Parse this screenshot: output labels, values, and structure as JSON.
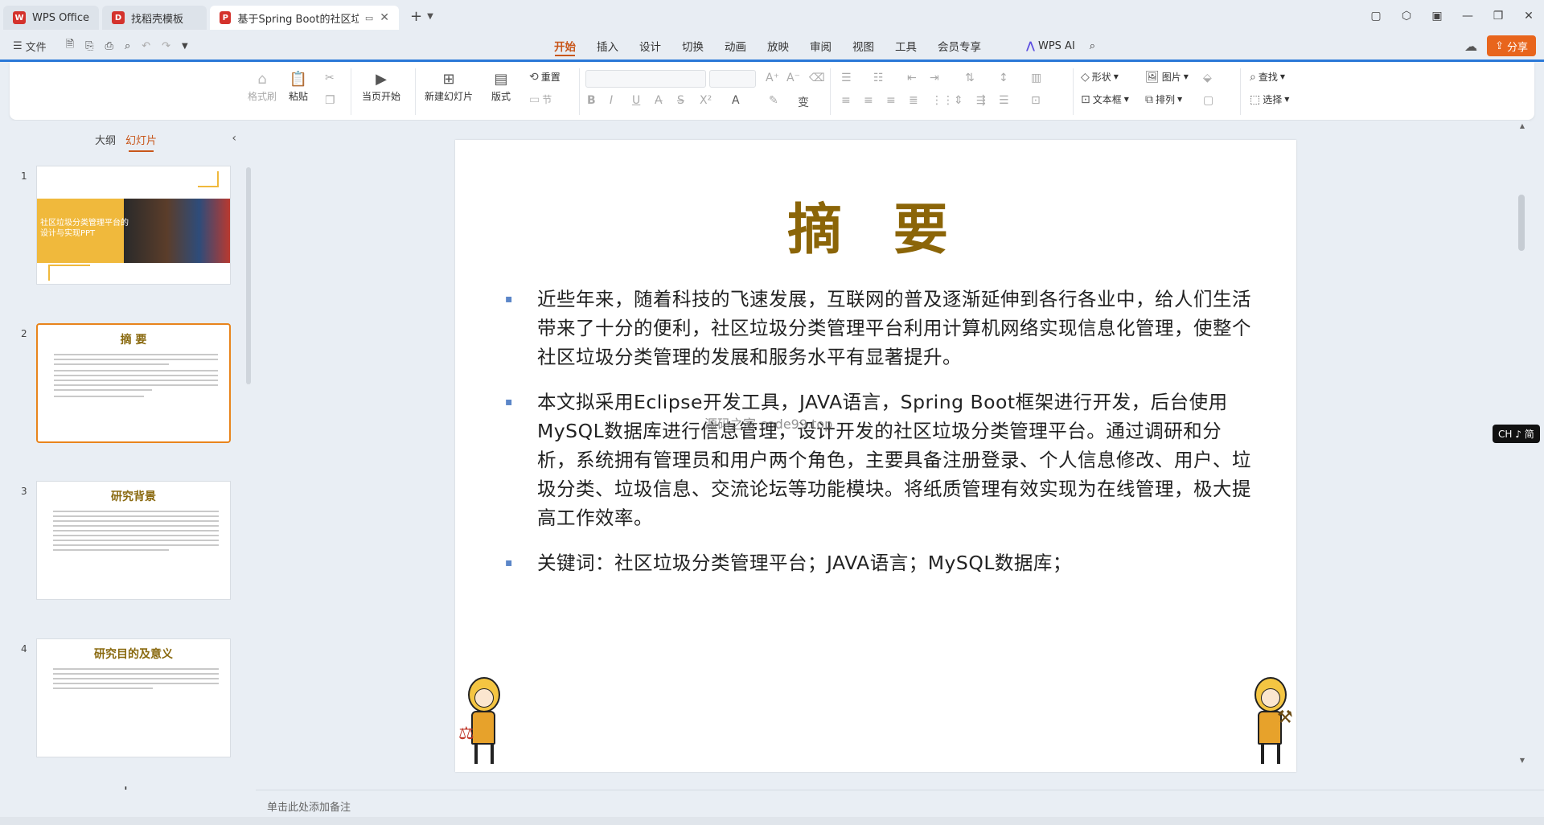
{
  "titlebar": {
    "tabs": [
      {
        "label": "WPS Office",
        "icon": "wps-logo-icon",
        "color": "#d4322c"
      },
      {
        "label": "找稻壳模板",
        "icon": "docer-logo-icon",
        "color": "#d4322c"
      },
      {
        "label": "基于Spring Boot的社区垃圾",
        "icon": "ppt-logo-icon",
        "color": "#d4322c"
      }
    ],
    "new_tab": "+"
  },
  "menubar": {
    "file_label": "文件",
    "tabs": [
      "开始",
      "插入",
      "设计",
      "切换",
      "动画",
      "放映",
      "审阅",
      "视图",
      "工具",
      "会员专享"
    ],
    "active_tab": "开始",
    "wps_ai": "WPS AI",
    "share": "分享",
    "accent": "#c8561a"
  },
  "ribbon": {
    "format_painter": "格式刷",
    "paste": "粘贴",
    "play_current": "当页开始",
    "new_slide": "新建幻灯片",
    "layout": "版式",
    "reset": "重置",
    "section": "节",
    "shape": "形状",
    "picture": "图片",
    "textbox": "文本框",
    "arrange": "排列",
    "find": "查找",
    "select": "选择"
  },
  "left_panel": {
    "tab_outline": "大纲",
    "tab_slides": "幻灯片",
    "active": "幻灯片",
    "thumbs": [
      {
        "num": "1",
        "title": "社区垃圾分类管理平台的设计与实现PPT"
      },
      {
        "num": "2",
        "title": "摘 要"
      },
      {
        "num": "3",
        "title": "研究背景"
      },
      {
        "num": "4",
        "title": "研究目的及意义"
      }
    ],
    "add": "+"
  },
  "slide": {
    "title": "摘 要",
    "bullets": [
      "近些年来，随着科技的飞速发展，互联网的普及逐渐延伸到各行各业中，给人们生活带来了十分的便利，社区垃圾分类管理平台利用计算机网络实现信息化管理，使整个社区垃圾分类管理的发展和服务水平有显著提升。",
      "本文拟采用Eclipse开发工具，JAVA语言，Spring Boot框架进行开发，后台使用MySQL数据库进行信息管理，设计开发的社区垃圾分类管理平台。通过调研和分析，系统拥有管理员和用户两个角色，主要具备注册登录、个人信息修改、用户、垃圾分类、垃圾信息、交流论坛等功能模块。将纸质管理有效实现为在线管理，极大提高工作效率。",
      "关键词：社区垃圾分类管理平台；JAVA语言；MySQL数据库；"
    ],
    "watermark": "源码之家 code99.top",
    "title_color": "#8b6508",
    "bullet_color": "#5b86c8"
  },
  "ime_badge": "CH ♪ 简",
  "notes_placeholder": "单击此处添加备注"
}
